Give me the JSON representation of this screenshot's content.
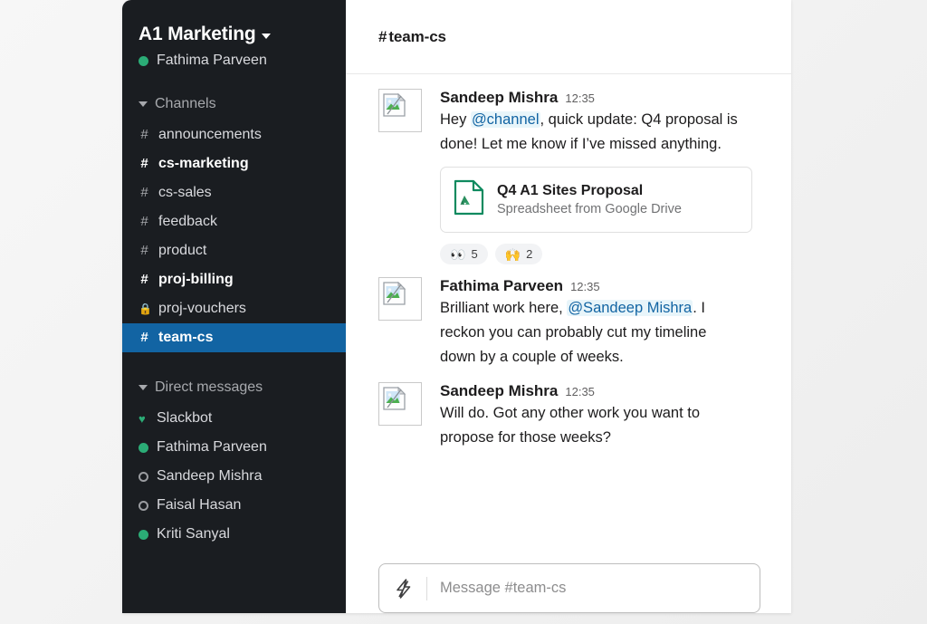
{
  "workspace": {
    "name": "A1 Marketing",
    "chevron_icon": "chevron-down-icon",
    "current_user": "Fathima Parveen",
    "current_user_presence": "online"
  },
  "sidebar": {
    "channels_section": {
      "label": "Channels",
      "caret_icon": "caret-down-icon",
      "items": [
        {
          "name": "announcements",
          "prefix": "#",
          "unread": false,
          "private": false,
          "active": false
        },
        {
          "name": "cs-marketing",
          "prefix": "#",
          "unread": true,
          "private": false,
          "active": false
        },
        {
          "name": "cs-sales",
          "prefix": "#",
          "unread": false,
          "private": false,
          "active": false
        },
        {
          "name": "feedback",
          "prefix": "#",
          "unread": false,
          "private": false,
          "active": false
        },
        {
          "name": "product",
          "prefix": "#",
          "unread": false,
          "private": false,
          "active": false
        },
        {
          "name": "proj-billing",
          "prefix": "#",
          "unread": true,
          "private": false,
          "active": false
        },
        {
          "name": "proj-vouchers",
          "prefix": "🔒",
          "unread": false,
          "private": true,
          "active": false
        },
        {
          "name": "team-cs",
          "prefix": "#",
          "unread": false,
          "private": false,
          "active": true
        }
      ]
    },
    "dms_section": {
      "label": "Direct messages",
      "caret_icon": "caret-down-icon",
      "items": [
        {
          "name": "Slackbot",
          "presence": "heart"
        },
        {
          "name": "Fathima Parveen",
          "presence": "online"
        },
        {
          "name": "Sandeep Mishra",
          "presence": "away"
        },
        {
          "name": "Faisal Hasan",
          "presence": "away"
        },
        {
          "name": "Kriti Sanyal",
          "presence": "online"
        }
      ]
    }
  },
  "channel": {
    "hash": "#",
    "name": "team-cs",
    "header_title": "team-cs"
  },
  "messages": [
    {
      "author": "Sandeep Mishra",
      "time": "12:35",
      "avatar_icon": "broken-image-icon",
      "segments": [
        {
          "text": "Hey ",
          "mention": false
        },
        {
          "text": "@channel",
          "mention": true
        },
        {
          "text": ", quick update: Q4 proposal is done! Let me know if I’ve missed anything.",
          "mention": false
        }
      ],
      "attachment": {
        "icon": "google-drive-file-icon",
        "title": "Q4 A1 Sites Proposal",
        "subtitle": "Spreadsheet from Google Drive"
      },
      "reactions": [
        {
          "emoji": "👀",
          "name": "eyes",
          "count": "5"
        },
        {
          "emoji": "🙌",
          "name": "raised-hands",
          "count": "2"
        }
      ]
    },
    {
      "author": "Fathima Parveen",
      "time": "12:35",
      "avatar_icon": "broken-image-icon",
      "segments": [
        {
          "text": "Brilliant work here, ",
          "mention": false
        },
        {
          "text": "@Sandeep Mishra",
          "mention": true
        },
        {
          "text": ". I reckon you can probably cut my timeline down by a couple of weeks.",
          "mention": false
        }
      ],
      "attachment": null,
      "reactions": []
    },
    {
      "author": "Sandeep Mishra",
      "time": "12:35",
      "avatar_icon": "broken-image-icon",
      "segments": [
        {
          "text": "Will do. Got any other work you want to propose for those weeks?",
          "mention": false
        }
      ],
      "attachment": null,
      "reactions": []
    }
  ],
  "composer": {
    "lightning_icon": "lightning-bolt-icon",
    "placeholder": "Message #team-cs"
  },
  "colors": {
    "sidebar_bg": "#1a1d21",
    "active_channel": "#1264a3",
    "mention_text": "#1264a3",
    "mention_bg": "#e8f5fa",
    "presence_online": "#2bac76",
    "drive_green": "#0f9d58"
  }
}
